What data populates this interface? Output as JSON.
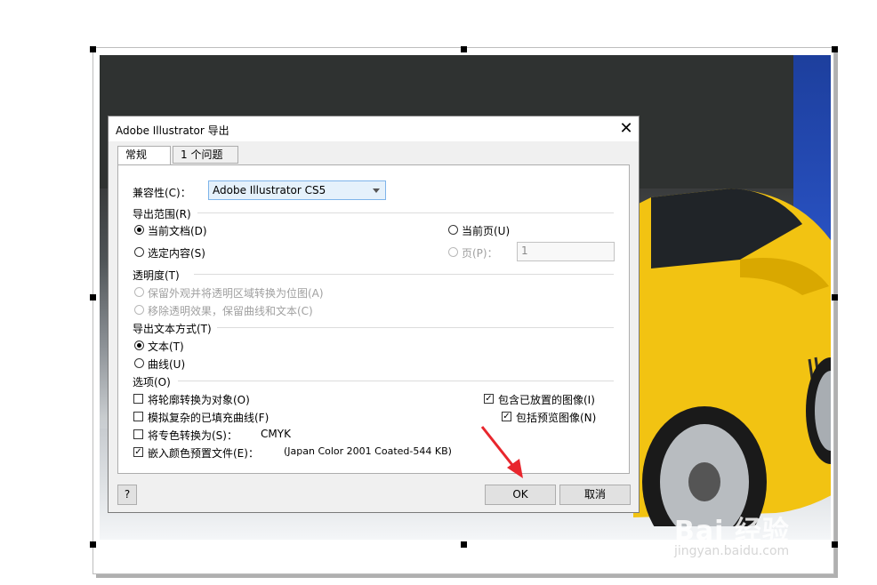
{
  "dialog": {
    "title": "Adobe Illustrator 导出",
    "close_glyph": "✕",
    "tabs": [
      {
        "label": "常规"
      },
      {
        "label": "1 个问题"
      }
    ],
    "compat": {
      "label": "兼容性(C)：",
      "value": "Adobe Illustrator CS5"
    },
    "export_range": {
      "header": "导出范围(R)",
      "current_doc": "当前文档(D)",
      "selection": "选定内容(S)",
      "current_page": "当前页(U)",
      "pages_label": "页(P)：",
      "pages_value": "1"
    },
    "transparency": {
      "header": "透明度(T)",
      "preserve": "保留外观并将透明区域转换为位图(A)",
      "remove": "移除透明效果，保留曲线和文本(C)"
    },
    "text_export": {
      "header": "导出文本方式(T)",
      "as_text": "文本(T)",
      "as_curves": "曲线(U)"
    },
    "options": {
      "header": "选项(O)",
      "outline_to_object": "将轮廓转换为对象(O)",
      "simulate_fills": "模拟复杂的已填充曲线(F)",
      "spot_to": "将专色转换为(S)：",
      "spot_value": "CMYK",
      "embed_profile": "嵌入颜色预置文件(E)：",
      "profile_value": "(Japan Color 2001 Coated-544 KB)",
      "include_placed": "包含已放置的图像(I)",
      "include_preview": "包括预览图像(N)"
    },
    "buttons": {
      "help": "?",
      "ok": "OK",
      "cancel": "取消"
    }
  },
  "watermark": {
    "logo": "Bai 经验",
    "url": "jingyan.baidu.com"
  },
  "colors": {
    "accent_arrow": "#e8262d",
    "car_yellow": "#f2c312",
    "select_bg": "#e5f1fb"
  }
}
